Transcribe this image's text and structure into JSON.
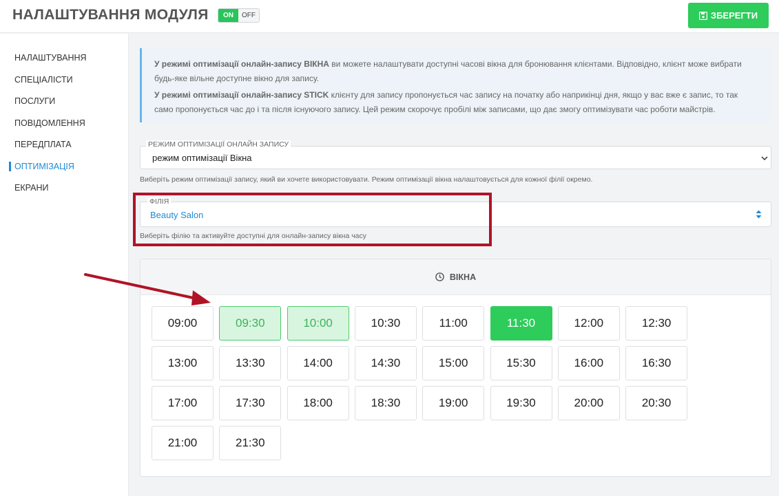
{
  "header": {
    "title": "НАЛАШТУВАННЯ МОДУЛЯ",
    "toggle_on": "ON",
    "toggle_off": "OFF",
    "save_label": "ЗБЕРЕГТИ",
    "save_icon": "floppy-disk-icon"
  },
  "sidebar": {
    "items": [
      {
        "label": "НАЛАШТУВАННЯ",
        "active": false
      },
      {
        "label": "СПЕЦІАЛІСТИ",
        "active": false
      },
      {
        "label": "ПОСЛУГИ",
        "active": false
      },
      {
        "label": "ПОВІДОМЛЕННЯ",
        "active": false
      },
      {
        "label": "ПЕРЕДПЛАТА",
        "active": false
      },
      {
        "label": "ОПТИМІЗАЦІЯ",
        "active": true
      },
      {
        "label": "ЕКРАНИ",
        "active": false
      }
    ]
  },
  "info": {
    "p1_bold": "У режимі оптимізації онлайн-запису ВІКНА",
    "p1_rest": " ви можете налаштувати доступні часові вікна для бронювання клієнтами. Відповідно, клієнт може вибрати будь-яке вільне доступне вікно для запису.",
    "p2_bold": "У режимі оптимізації онлайн-запису STICK",
    "p2_rest": " клієнту для запису пропонується час запису на початку або наприкінці дня, якщо у вас вже є запис, то так само пропонується час до і та після існуючого запису. Цей режим скорочує пробілі між записами, що дає змогу оптимізувати час роботи майстрів."
  },
  "mode_select": {
    "label": "РЕЖИМ ОПТИМІЗАЦІЇ ОНЛАЙН ЗАПИСУ",
    "value": "режим оптимізації Вікна",
    "help": "Виберіть режим оптимізації запису, який ви хочете використовувати. Режим оптимізації вікна налаштовується для кожної філії окремо."
  },
  "branch_select": {
    "label": "ФІЛІЯ",
    "value": "Beauty Salon",
    "help": "Виберіть філію та активуйте доступні для онлайн-запису вікна часу"
  },
  "windows": {
    "title": "ВІКНА",
    "icon": "clock-icon",
    "slots": [
      {
        "time": "09:00",
        "state": "default"
      },
      {
        "time": "09:30",
        "state": "light"
      },
      {
        "time": "10:00",
        "state": "light"
      },
      {
        "time": "10:30",
        "state": "default"
      },
      {
        "time": "11:00",
        "state": "default"
      },
      {
        "time": "11:30",
        "state": "active"
      },
      {
        "time": "12:00",
        "state": "default"
      },
      {
        "time": "12:30",
        "state": "default"
      },
      {
        "time": "13:00",
        "state": "default"
      },
      {
        "time": "13:30",
        "state": "default"
      },
      {
        "time": "14:00",
        "state": "default"
      },
      {
        "time": "14:30",
        "state": "default"
      },
      {
        "time": "15:00",
        "state": "default"
      },
      {
        "time": "15:30",
        "state": "default"
      },
      {
        "time": "16:00",
        "state": "default"
      },
      {
        "time": "16:30",
        "state": "default"
      },
      {
        "time": "17:00",
        "state": "default"
      },
      {
        "time": "17:30",
        "state": "default"
      },
      {
        "time": "18:00",
        "state": "default"
      },
      {
        "time": "18:30",
        "state": "default"
      },
      {
        "time": "19:00",
        "state": "default"
      },
      {
        "time": "19:30",
        "state": "default"
      },
      {
        "time": "20:00",
        "state": "default"
      },
      {
        "time": "20:30",
        "state": "default"
      },
      {
        "time": "21:00",
        "state": "default"
      },
      {
        "time": "21:30",
        "state": "default"
      }
    ]
  },
  "colors": {
    "accent_green": "#2ecc5a",
    "link_blue": "#1f8ad6",
    "annotation_red": "#b01327"
  }
}
